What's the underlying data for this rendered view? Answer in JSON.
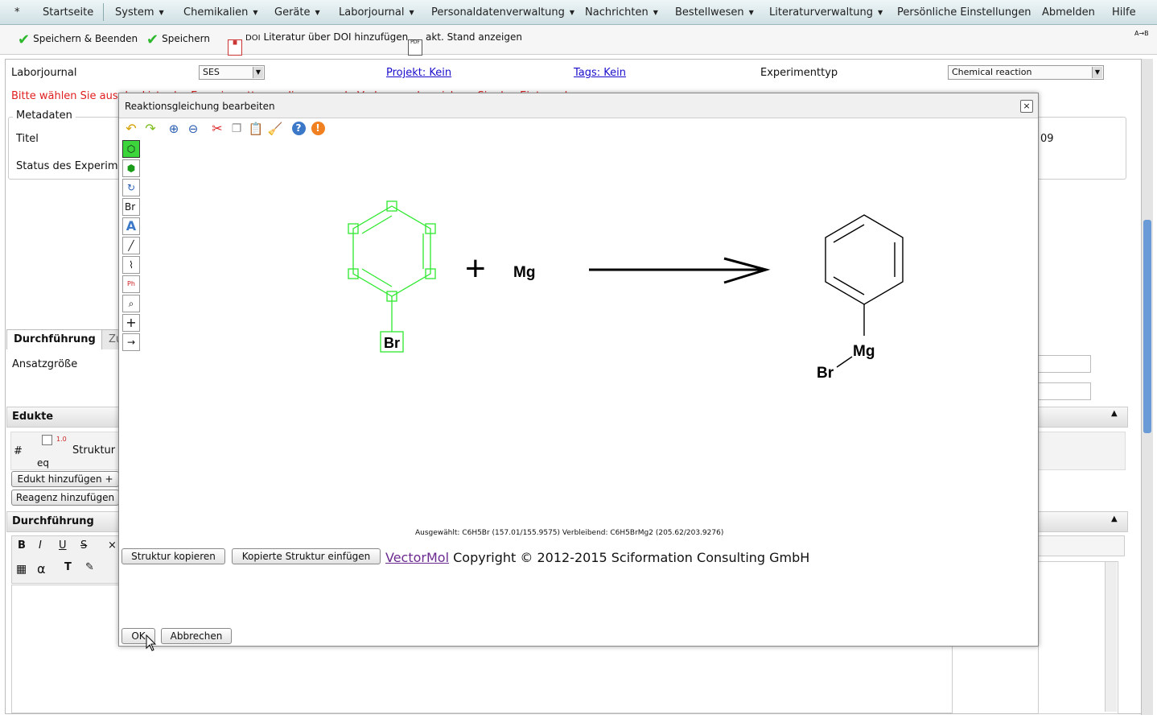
{
  "menu": {
    "items": [
      {
        "label": "*",
        "arrow": false
      },
      {
        "label": "Startseite",
        "arrow": false
      },
      {
        "label": "System",
        "arrow": true
      },
      {
        "label": "Chemikalien",
        "arrow": true
      },
      {
        "label": "Geräte",
        "arrow": true
      },
      {
        "label": "Laborjournal",
        "arrow": true
      },
      {
        "label": "Personaldatenverwaltung",
        "arrow": true
      },
      {
        "label": "Nachrichten",
        "arrow": true
      },
      {
        "label": "Bestellwesen",
        "arrow": true
      },
      {
        "label": "Literaturverwaltung",
        "arrow": true
      },
      {
        "label": "Persönliche Einstellungen",
        "arrow": false
      },
      {
        "label": "Abmelden",
        "arrow": false
      },
      {
        "label": "Hilfe",
        "arrow": false
      }
    ]
  },
  "toolbar": {
    "save_close": "Speichern & Beenden",
    "save": "Speichern",
    "doi_tag": "DOI",
    "doi_add": "Literatur über DOI hinzufügen",
    "pdf_tag": "PDF",
    "current_state": "akt. Stand anzeigen",
    "toggle": "A→B"
  },
  "header": {
    "journal_label": "Laborjournal",
    "journal_value": "SES",
    "project_link": "Projekt: Kein",
    "tags_link": "Tags: Kein",
    "exp_type_label": "Experimenttyp",
    "exp_type_value": "Chemical reaction",
    "warning": "Bitte wählen Sie aus der Liste der Experimenttypen die passende Vorlage und speichern Sie den Eintrag dann."
  },
  "metadata": {
    "legend": "Metadaten",
    "title_label": "Titel",
    "status_label": "Status des Experiments",
    "date_fragment": "09"
  },
  "tabs": {
    "active": "Durchführung",
    "inactive": "Zu"
  },
  "procedure": {
    "batch_label": "Ansatzgröße"
  },
  "educts": {
    "header": "Edukte",
    "col_hash": "#",
    "col_eq": "eq",
    "col_structure": "Struktur",
    "eq_badge": "1.0",
    "add_educt": "Edukt hinzufügen +",
    "add_reagent": "Reagenz hinzufügen"
  },
  "execution": {
    "header": "Durchführung",
    "bold": "B",
    "italic": "I",
    "underline": "U",
    "strike": "S",
    "sub": "×"
  },
  "dialog": {
    "title": "Reaktionsgleichung bearbeiten",
    "close": "×",
    "formula_text": "Ausgewählt: C6H5Br (157.01/155.9575) Verbleibend: C6H5BrMg2 (205.62/203.9276)",
    "copy_structure": "Struktur kopieren",
    "paste_structure": "Kopierte Struktur einfügen",
    "vectormol": "VectorMol",
    "copyright": "Copyright © 2012-2015 Sciformation Consulting GmbH",
    "ok": "OK",
    "cancel": "Abbrechen",
    "tool_element": "Br",
    "tool_text": "A",
    "tool_plus": "+"
  },
  "molecules": {
    "reactant_atom": "Br",
    "plus": "+",
    "reagent": "Mg",
    "product_mg": "Mg",
    "product_br": "Br"
  },
  "colors": {
    "selection": "#2ee82e",
    "warning": "#e02020",
    "link": "#1a0dcc",
    "vectormol": "#6b2a8f"
  }
}
